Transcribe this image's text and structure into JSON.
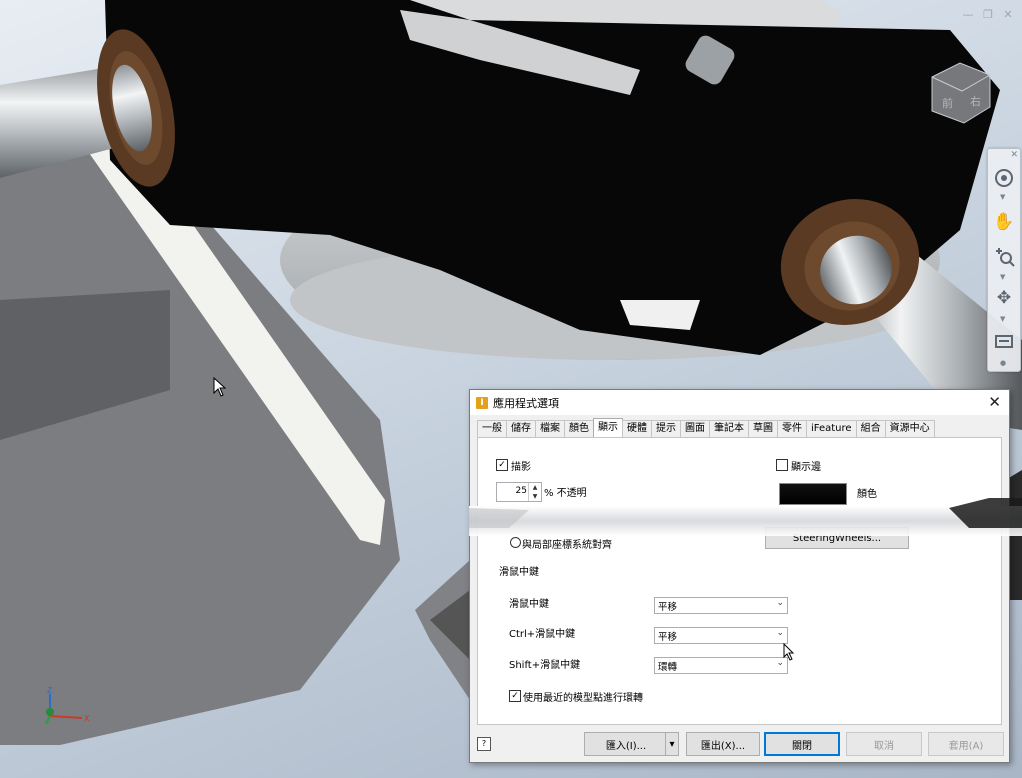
{
  "window_controls": {
    "minimize": "—",
    "restore": "❐",
    "close": "✕"
  },
  "viewcube": {
    "face_front": "前",
    "face_right": "右"
  },
  "navbar": {
    "close": "✕"
  },
  "axis": {
    "z": "Z",
    "x": "X"
  },
  "dialog": {
    "title": "應用程式選項",
    "close": "✕",
    "app_icon": "I",
    "tabs": [
      {
        "label": "一般"
      },
      {
        "label": "儲存"
      },
      {
        "label": "檔案"
      },
      {
        "label": "顏色"
      },
      {
        "label": "顯示",
        "active": true
      },
      {
        "label": "硬體"
      },
      {
        "label": "提示"
      },
      {
        "label": "圖面"
      },
      {
        "label": "筆記本"
      },
      {
        "label": "草圖"
      },
      {
        "label": "零件"
      },
      {
        "label": "iFeature"
      },
      {
        "label": "組合"
      },
      {
        "label": "資源中心"
      }
    ],
    "shadow": {
      "label": "描影",
      "checked": true
    },
    "opacity": {
      "value": "25",
      "suffix": "% 不透明"
    },
    "show_edges": {
      "label": "顯示邊",
      "checked": false
    },
    "color": {
      "label": "顏色",
      "swatch": "#000000"
    },
    "align_radio": {
      "label": "與局部座標系統對齊",
      "selected": false
    },
    "steering_button": "SteeringWheels...",
    "mouse_section": {
      "title": "滑鼠中鍵",
      "rows": [
        {
          "label": "滑鼠中鍵",
          "value": "平移"
        },
        {
          "label": "Ctrl+滑鼠中鍵",
          "value": "平移"
        },
        {
          "label": "Shift+滑鼠中鍵",
          "value": "環轉"
        }
      ]
    },
    "recent_point": {
      "label": "使用最近的模型點進行環轉",
      "checked": true
    },
    "footer": {
      "help": "?",
      "import": "匯入(I)...",
      "export": "匯出(X)...",
      "close": "關閉",
      "cancel": "取消",
      "apply": "套用(A)"
    }
  }
}
